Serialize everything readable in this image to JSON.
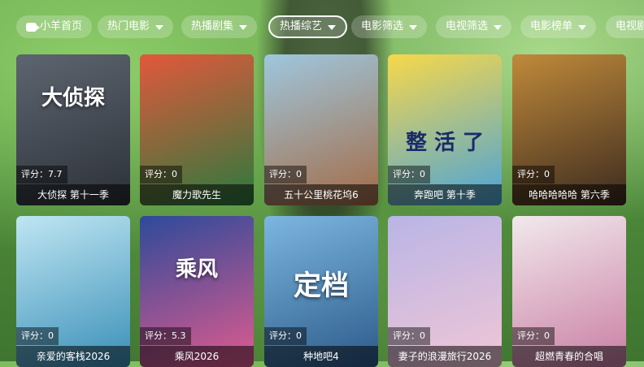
{
  "nav": {
    "items": [
      {
        "label": "小羊首页",
        "icon": "home-icon"
      },
      {
        "label": "热门电影",
        "icon": "filter-icon"
      },
      {
        "label": "热播剧集",
        "icon": "filter-icon"
      },
      {
        "label": "热播综艺",
        "icon": "filter-icon",
        "active": true
      },
      {
        "label": "电影筛选",
        "icon": "filter-icon"
      },
      {
        "label": "电视筛选",
        "icon": "filter-icon"
      },
      {
        "label": "电影榜单",
        "icon": "filter-icon"
      },
      {
        "label": "电视剧",
        "icon": ""
      }
    ]
  },
  "cards": [
    {
      "title": "大侦探 第十一季",
      "rating": "评分：7.7",
      "poster_text": "大侦探",
      "colors": [
        "#5d6570",
        "#2c3138"
      ]
    },
    {
      "title": "魔力歌先生",
      "rating": "评分：0",
      "poster_text": "",
      "colors": [
        "#e2583b",
        "#2a7a3e"
      ]
    },
    {
      "title": "五十公里桃花坞6",
      "rating": "评分：0",
      "poster_text": "",
      "colors": [
        "#9ec7de",
        "#a36b45"
      ]
    },
    {
      "title": "奔跑吧 第十季",
      "rating": "评分：0",
      "poster_text": "整 活 了",
      "colors": [
        "#f7d84a",
        "#4aa3d9"
      ]
    },
    {
      "title": "哈哈哈哈哈 第六季",
      "rating": "评分：0",
      "poster_text": "",
      "colors": [
        "#c08a3a",
        "#3b2a1f"
      ]
    },
    {
      "title": "亲爱的客栈2026",
      "rating": "评分：0",
      "poster_text": "",
      "colors": [
        "#bfe6f2",
        "#3a8fb8"
      ]
    },
    {
      "title": "乘风2026",
      "rating": "评分：5.3",
      "poster_text": "乘风",
      "colors": [
        "#2d4a9a",
        "#e05b8e"
      ]
    },
    {
      "title": "种地吧4",
      "rating": "评分：0",
      "poster_text": "定档",
      "colors": [
        "#7cb7e0",
        "#2c5a8a"
      ]
    },
    {
      "title": "妻子的浪漫旅行2026",
      "rating": "评分：0",
      "poster_text": "",
      "colors": [
        "#b9b5e6",
        "#f0c6d6"
      ]
    },
    {
      "title": "超燃青春的合唱",
      "rating": "评分：0",
      "poster_text": "",
      "colors": [
        "#f1e9ec",
        "#c97ea3"
      ]
    }
  ]
}
